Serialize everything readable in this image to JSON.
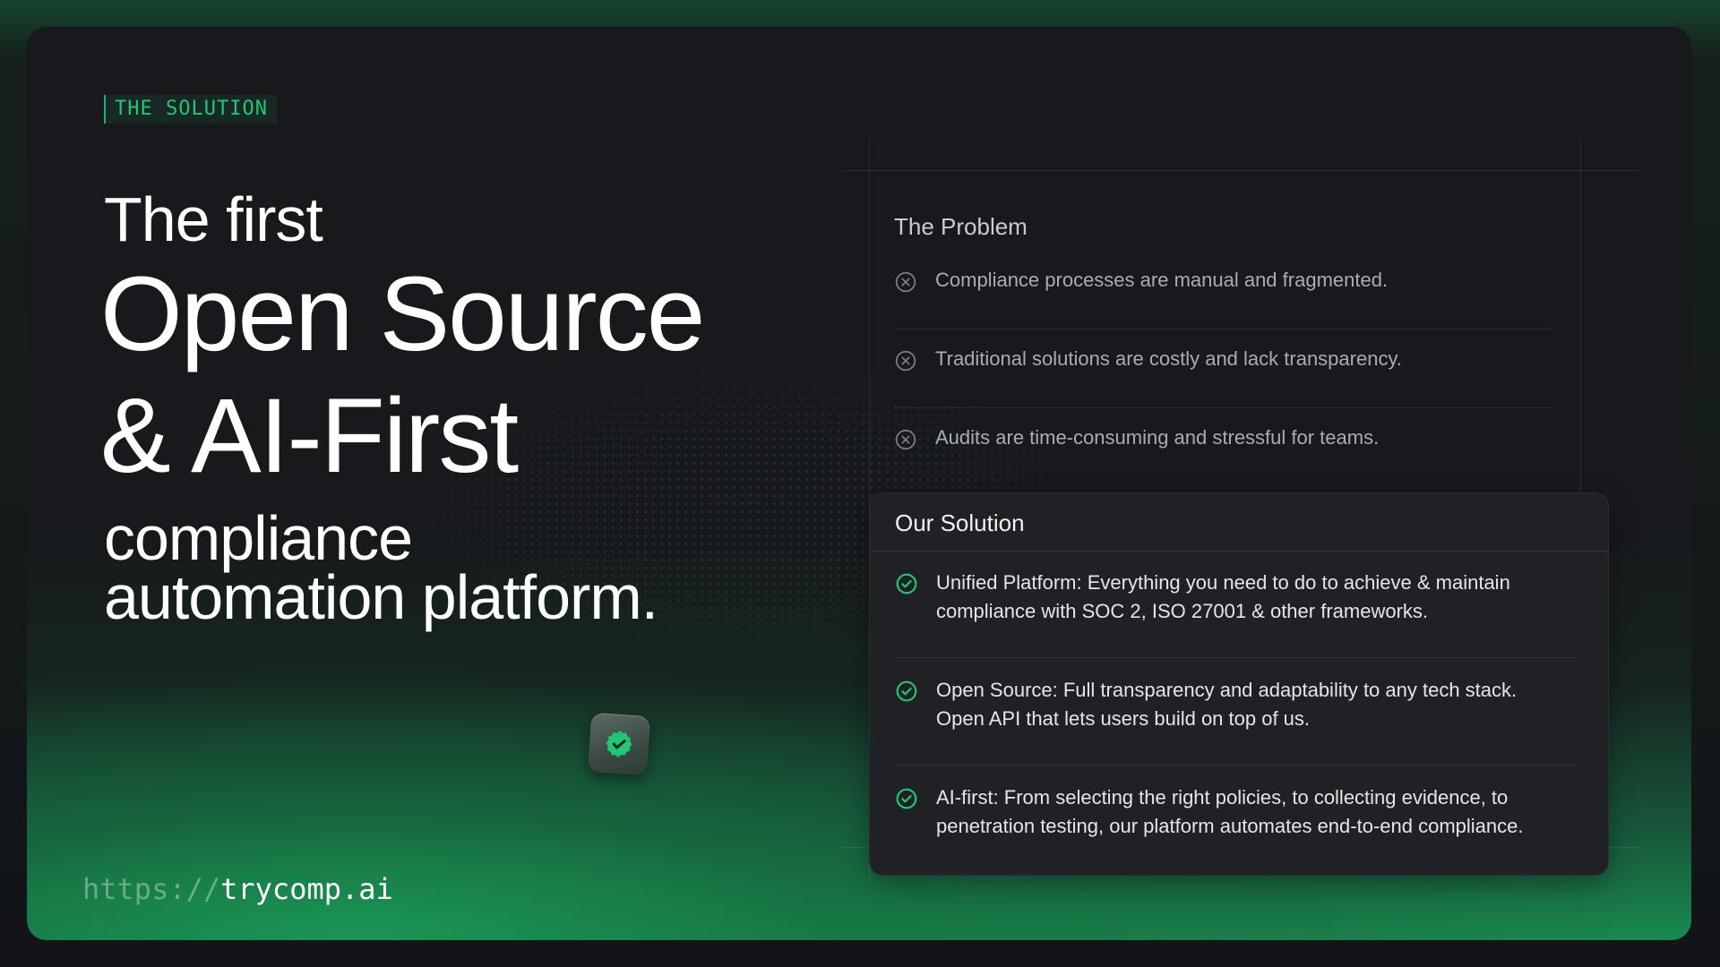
{
  "tag": "THE SOLUTION",
  "headline": {
    "line1": "The first",
    "line2": "Open Source",
    "line3": "& AI-First",
    "line4": "compliance",
    "line5": "automation platform."
  },
  "url": {
    "protocol": "https://",
    "host": "trycomp.ai"
  },
  "colors": {
    "accent": "#22c773",
    "background": "#17191d",
    "panel": "#1f2125"
  },
  "problem": {
    "title": "The Problem",
    "items": [
      {
        "icon": "x-circle-icon",
        "text": "Compliance processes are manual and fragmented."
      },
      {
        "icon": "x-circle-icon",
        "text": "Traditional solutions are costly and lack transparency."
      },
      {
        "icon": "x-circle-icon",
        "text": "Audits are time-consuming and stressful for teams."
      }
    ]
  },
  "solution": {
    "title": "Our Solution",
    "items": [
      {
        "icon": "check-circle-icon",
        "line1": "Unified Platform:  Everything you need to do to achieve & maintain",
        "line2": "compliance with SOC 2, ISO 27001 & other frameworks."
      },
      {
        "icon": "check-circle-icon",
        "line1": "Open Source: Full transparency and adaptability to any tech stack.",
        "line2": "Open API that lets users build on top of us."
      },
      {
        "icon": "check-circle-icon",
        "line1": "AI-first: From selecting the right policies, to collecting evidence, to",
        "line2": "penetration testing, our platform automates end-to-end compliance."
      }
    ]
  }
}
